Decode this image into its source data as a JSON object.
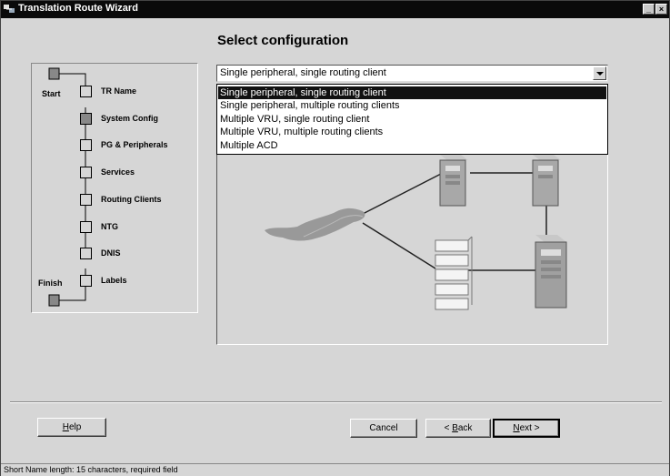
{
  "window": {
    "title": "Translation Route Wizard",
    "controls": {
      "minimize": "_",
      "close": "×"
    }
  },
  "page": {
    "heading": "Select configuration"
  },
  "nav": {
    "start_label": "Start",
    "finish_label": "Finish",
    "steps": [
      {
        "label": "TR Name",
        "done": false
      },
      {
        "label": "System Config",
        "done": true
      },
      {
        "label": "PG & Peripherals",
        "done": false
      },
      {
        "label": "Services",
        "done": false
      },
      {
        "label": "Routing Clients",
        "done": false
      },
      {
        "label": "NTG",
        "done": false
      },
      {
        "label": "DNIS",
        "done": false
      },
      {
        "label": "Labels",
        "done": false
      }
    ]
  },
  "config_select": {
    "value": "Single peripheral, single routing client",
    "options": [
      "Single peripheral, single routing client",
      "Single peripheral, multiple routing clients",
      "Multiple  VRU, single routing client",
      "Multiple  VRU, multiple routing clients",
      "Multiple ACD"
    ],
    "selected_index": 0
  },
  "buttons": {
    "help": {
      "mnemonic": "H",
      "rest": "elp"
    },
    "cancel": "Cancel",
    "back": {
      "prefix": "< ",
      "mnemonic": "B",
      "rest": "ack"
    },
    "next": {
      "mnemonic": "N",
      "rest": "ext >"
    }
  },
  "status": {
    "text": "Short Name length: 15 characters, required field"
  }
}
